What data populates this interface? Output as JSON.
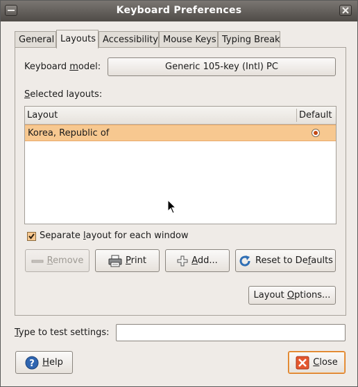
{
  "window": {
    "title": "Keyboard Preferences"
  },
  "tabs": [
    {
      "label": "General"
    },
    {
      "label": "Layouts"
    },
    {
      "label": "Accessibility"
    },
    {
      "label": "Mouse Keys"
    },
    {
      "label": "Typing Break"
    }
  ],
  "active_tab": "Layouts",
  "keyboard_model": {
    "label_pre": "Keyboard ",
    "label_mnemonic": "m",
    "label_post": "odel:",
    "value": "Generic 105-key (Intl) PC"
  },
  "selected_layouts": {
    "label_mnemonic": "S",
    "label_post": "elected layouts:"
  },
  "layout_list": {
    "columns": [
      "Layout",
      "Default"
    ],
    "rows": [
      {
        "layout": "Korea, Republic of",
        "default": true
      }
    ]
  },
  "separate_layout": {
    "pre": "Separate ",
    "mnemonic": "l",
    "post": "ayout for each window",
    "checked": true
  },
  "buttons": {
    "remove": {
      "mnemonic": "R",
      "post": "emove",
      "enabled": false
    },
    "print": {
      "mnemonic": "P",
      "post": "rint"
    },
    "add": {
      "mnemonic": "A",
      "post": "dd..."
    },
    "reset": {
      "pre": "Reset to De",
      "mnemonic": "f",
      "post": "aults"
    },
    "layout_options": {
      "pre": "Layout ",
      "mnemonic": "O",
      "post": "ptions..."
    },
    "help": {
      "mnemonic": "H",
      "post": "elp"
    },
    "close": {
      "mnemonic": "C",
      "post": "lose"
    }
  },
  "test_settings": {
    "mnemonic": "T",
    "post": "ype to test settings:",
    "value": ""
  },
  "colors": {
    "selection": "#f7c890",
    "close_focus": "#d9781f",
    "titlebar": "#5e5a56"
  }
}
